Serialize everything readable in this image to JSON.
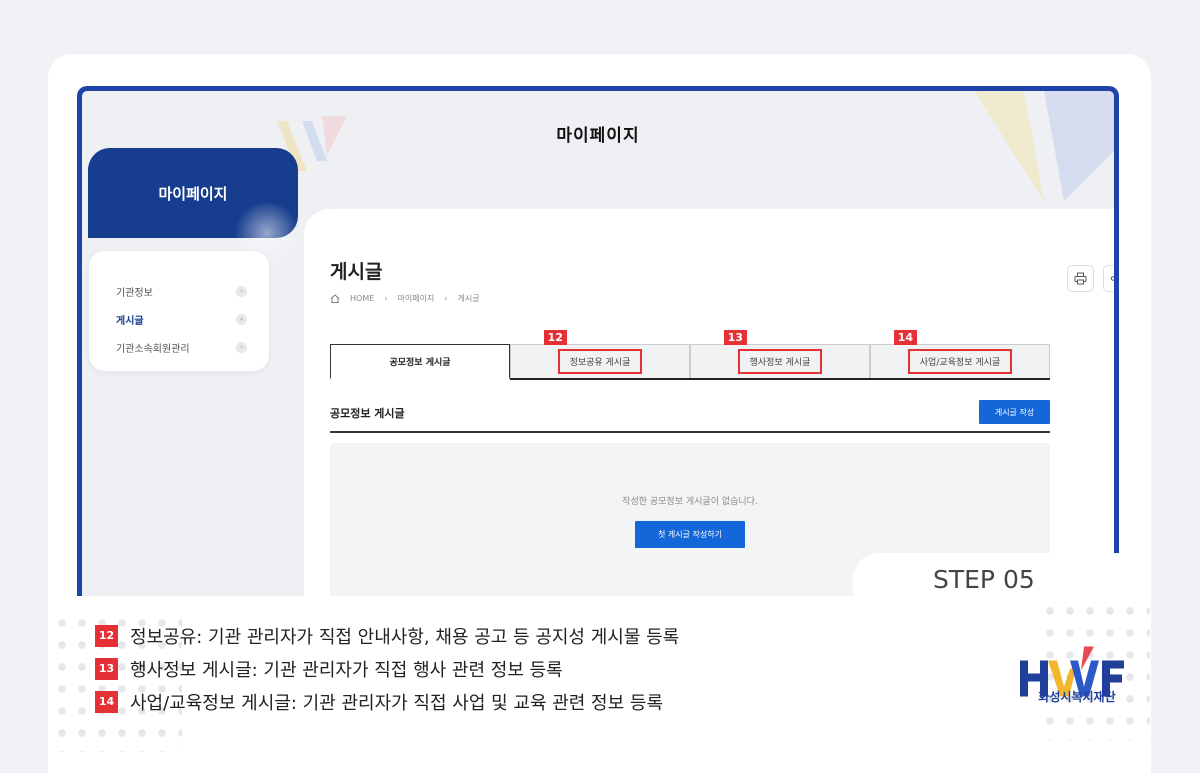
{
  "site": {
    "title": "마이페이지"
  },
  "sidebar": {
    "heading": "마이페이지",
    "items": [
      {
        "label": "기관정보",
        "active": false
      },
      {
        "label": "게시글",
        "active": true
      },
      {
        "label": "기관소속회원관리",
        "active": false
      }
    ]
  },
  "page": {
    "title": "게시글",
    "breadcrumb": [
      "HOME",
      "마이페이지",
      "게시글"
    ]
  },
  "tabs": [
    {
      "label": "공모정보 게시글",
      "active": true,
      "marker": ""
    },
    {
      "label": "정보공유 게시글",
      "active": false,
      "marker": "12"
    },
    {
      "label": "행사정보 게시글",
      "active": false,
      "marker": "13"
    },
    {
      "label": "사업/교육정보 게시글",
      "active": false,
      "marker": "14"
    }
  ],
  "section": {
    "title": "공모정보 게시글",
    "write_button": "게시글 작성",
    "empty_message": "작성한 공모정보 게시글이 없습니다.",
    "first_post_button": "첫 게시글 작성하기"
  },
  "step": "STEP 05",
  "notes": [
    {
      "num": "12",
      "text": "정보공유: 기관 관리자가 직접 안내사항, 채용 공고 등 공지성 게시물 등록"
    },
    {
      "num": "13",
      "text": "행사정보 게시글: 기관 관리자가 직접 행사 관련 정보 등록"
    },
    {
      "num": "14",
      "text": "사업/교육정보 게시글: 기관 관리자가 직접 사업 및 교육 관련 정보 등록"
    }
  ],
  "logo": {
    "letters": "HWF",
    "name": "화성시복지재단"
  },
  "colors": {
    "brand_blue": "#1e43a8",
    "button_blue": "#1467d9",
    "marker_red": "#e53036",
    "sidebar_navy": "#173d8e"
  }
}
